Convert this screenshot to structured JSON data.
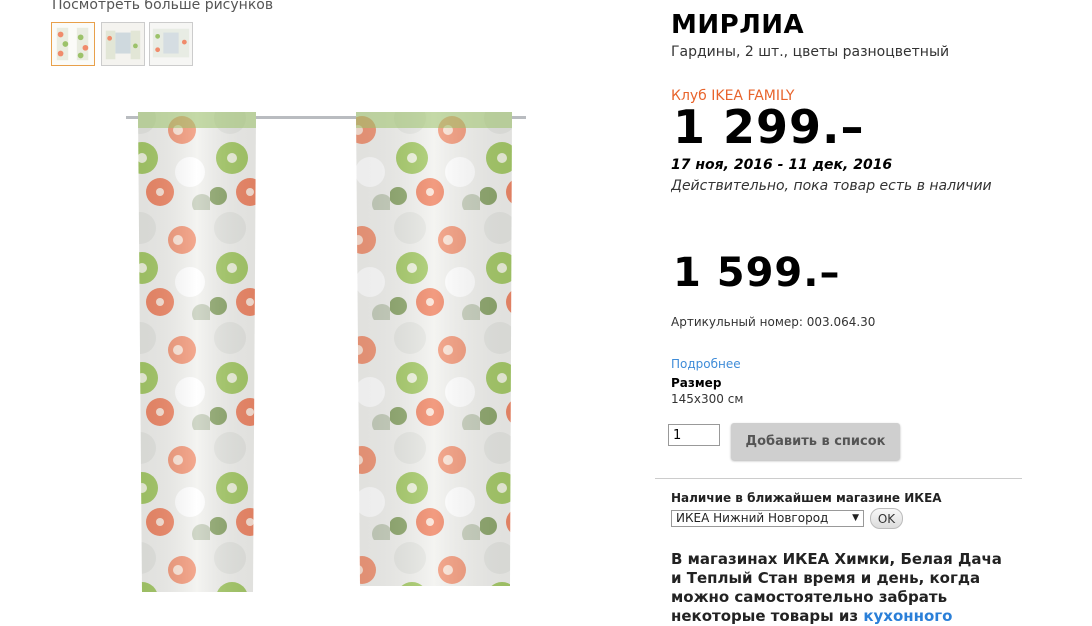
{
  "gallery": {
    "more_images": "Посмотреть больше рисунков",
    "thumbnails": [
      "thumb-front",
      "thumb-room",
      "thumb-window"
    ],
    "selected_index": 0
  },
  "product": {
    "name": "МИРЛИА",
    "description": "Гардины, 2 шт., цветы разноцветный",
    "family_label": "Клуб IKEA FAMILY",
    "family_price": "1 299.–",
    "family_dates": "17 ноя, 2016 - 11 дек, 2016",
    "family_validity": "Действительно, пока товар есть в наличии",
    "regular_price": "1 599.–",
    "article": "Артикульный номер: 003.064.30",
    "more_info": "Подробнее",
    "size_label": "Размер",
    "size_value": "145x300 см"
  },
  "cart": {
    "quantity": "1",
    "add_button": "Добавить в список"
  },
  "availability": {
    "title": "Наличие в ближайшем магазине ИКЕА",
    "selected_store": "ИКЕА Нижний Новгород",
    "ok_button": "OK"
  },
  "promo": {
    "text": "В магазинах ИКЕА Химки, Белая Дача и Теплый Стан время и день, когда можно самостоятельно забрать некоторые товары из ",
    "link": "кухонного"
  },
  "colors": {
    "family_accent": "#e8642c",
    "link": "#3f8cd8"
  }
}
